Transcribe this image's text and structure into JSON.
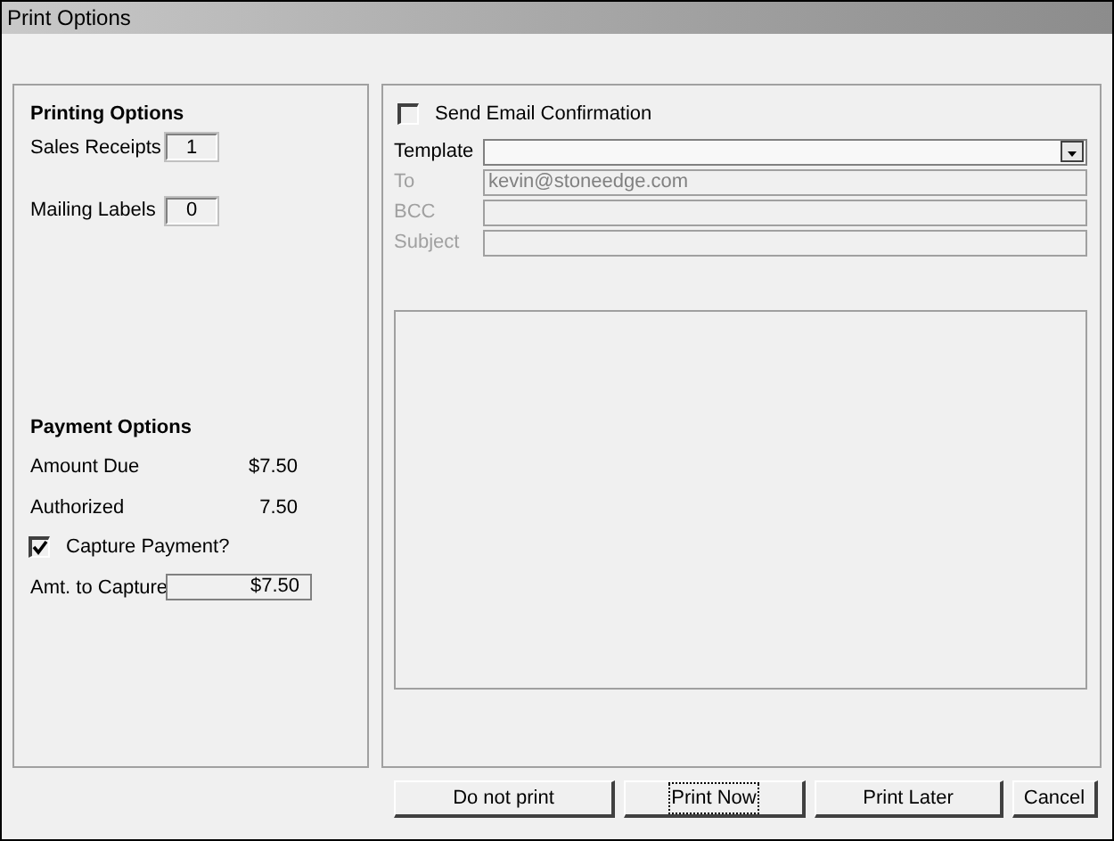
{
  "window": {
    "title": "Print Options"
  },
  "printing_options": {
    "title": "Printing Options",
    "rows": [
      {
        "label": "Sales Receipts",
        "value": "1"
      },
      {
        "label": "Mailing Labels",
        "value": "0"
      }
    ]
  },
  "payment_options": {
    "title": "Payment Options",
    "rows": [
      {
        "label": "Amount Due",
        "value": "$7.50"
      },
      {
        "label": "Authorized",
        "value": "7.50"
      }
    ],
    "capture": {
      "label": "Capture Payment?",
      "checked": true
    },
    "amount_to_capture": {
      "label": "Amt. to Capture",
      "value": "$7.50"
    }
  },
  "email": {
    "send_confirmation": {
      "label": "Send Email Confirmation",
      "checked": false
    },
    "fields": [
      {
        "kind": "dropdown",
        "label": "Template",
        "disabled": false
      },
      {
        "kind": "text",
        "label": "To",
        "value": "kevin@stoneedge.com",
        "disabled": true
      },
      {
        "kind": "text",
        "label": "BCC",
        "disabled": true
      },
      {
        "kind": "text",
        "label": "Subject",
        "disabled": true
      }
    ]
  },
  "buttons": [
    {
      "label": "Do not print",
      "focused": false
    },
    {
      "label": "Print Now",
      "focused": true
    },
    {
      "label": "Print Later",
      "focused": false
    },
    {
      "label": "Cancel",
      "focused": false
    }
  ]
}
